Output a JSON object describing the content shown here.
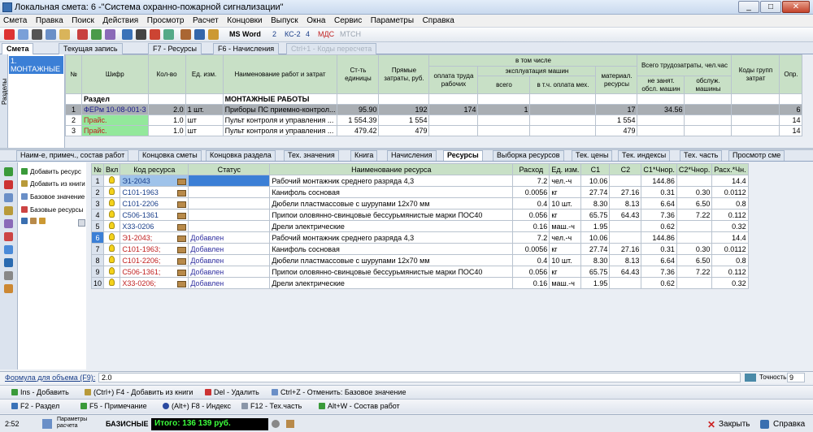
{
  "window": {
    "title": "Локальная смета: 6 -\"Система охранно-пожарной сигнализации\"",
    "min": "_",
    "max": "□",
    "close": "✕"
  },
  "menu": [
    "Смета",
    "Правка",
    "Поиск",
    "Действия",
    "Просмотр",
    "Расчет",
    "Концовки",
    "Выпуск",
    "Окна",
    "Сервис",
    "Параметры",
    "Справка"
  ],
  "toolbar": {
    "msword": "MS Word",
    "n2": "2",
    "ks2": "КС-2",
    "n4": "4",
    "mds": "МДС",
    "mtsn": "МТСН"
  },
  "top_tabs": [
    "Смета",
    "Текущая запись",
    "F7 - Ресурсы",
    "F6 - Начисления",
    "Ctrl+1 - Коды пересчета"
  ],
  "left_strip": "Разделы",
  "sections": {
    "selected": "1. МОНТАЖНЫЕ"
  },
  "estimate_table": {
    "headers": {
      "num": "№",
      "code": "Шифр",
      "qty": "Кол-во",
      "unit": "Ед. изм.",
      "name": "Наименование работ и затрат",
      "unit_cost": "Ст-ть единицы",
      "direct": "Прямые затраты, руб.",
      "incl": "в том числе",
      "wages": "оплата труда рабочих",
      "machine": "эксплуатация машин",
      "total": "всего",
      "incl_wages": "в т.ч. оплата мех.",
      "materials": "материал. ресурсы",
      "labor": "Всего трудозатраты, чел.час",
      "not_busy": "не занят. обсл. машин",
      "service": "обслуж. машины",
      "group_codes": "Коды групп затрат",
      "opr": "Опр."
    },
    "section_row": {
      "label": "Раздел",
      "title": "МОНТАЖНЫЕ РАБОТЫ"
    },
    "rows": [
      {
        "n": "1",
        "code": "ФЕРм 10-08-001-3",
        "qty": "2.0",
        "unit": "1 шт.",
        "name": "Приборы ПС приемно-контрол...",
        "unit_cost": "95.90",
        "direct": "192",
        "wages": "174",
        "mach": "1",
        "mach_w": "",
        "mat": "17",
        "labor": "34.56",
        "serv": "",
        "grp": "",
        "opr": "6"
      },
      {
        "n": "2",
        "code": "Прайс.",
        "qty": "1.0",
        "unit": "шт",
        "name": "Пульт контроля и управления ...",
        "unit_cost": "1 554.39",
        "direct": "1 554",
        "wages": "",
        "mach": "",
        "mach_w": "",
        "mat": "1 554",
        "labor": "",
        "serv": "",
        "grp": "",
        "opr": "14"
      },
      {
        "n": "3",
        "code": "Прайс.",
        "qty": "1.0",
        "unit": "шт",
        "name": "Пульт контроля и управления ...",
        "unit_cost": "479.42",
        "direct": "479",
        "wages": "",
        "mach": "",
        "mach_w": "",
        "mat": "479",
        "labor": "",
        "serv": "",
        "grp": "",
        "opr": "14"
      }
    ]
  },
  "bottom_tabs": [
    "Наим-е, примеч., состав работ",
    "Концовка сметы",
    "Концовка раздела",
    "Тех. значения",
    "Книга",
    "Начисления",
    "Ресурсы",
    "Выборка ресурсов",
    "Тек. цены",
    "Тек. индексы",
    "Тех. часть",
    "Просмотр сме"
  ],
  "resource_panel": [
    "Добавить ресурс",
    "Добавить из книги",
    "Базовое значение",
    "Базовые ресурсы"
  ],
  "resources_table": {
    "headers": {
      "n": "№",
      "incl": "Вкл",
      "code": "Код ресурса",
      "status": "Статус",
      "name": "Наименование ресурса",
      "cons": "Расход",
      "unit": "Ед. изм.",
      "c1": "С1",
      "c2": "С2",
      "c1n": "С1*Чнор.",
      "c2n": "С2*Чнор.",
      "rn": "Расх.*Чн."
    },
    "rows": [
      {
        "n": "1",
        "code": "Э1-2043",
        "status": "",
        "name": "Рабочий монтажник среднего разряда 4,3",
        "cons": "7.2",
        "unit": "чел.-ч",
        "c1": "10.06",
        "c2": "",
        "c1n": "144.86",
        "c2n": "",
        "rn": "14.4",
        "red": false
      },
      {
        "n": "2",
        "code": "С101-1963",
        "status": "",
        "name": "Канифоль сосновая",
        "cons": "0.0056",
        "unit": "кг",
        "c1": "27.74",
        "c2": "27.16",
        "c1n": "0.31",
        "c2n": "0.30",
        "rn": "0.0112",
        "red": false
      },
      {
        "n": "3",
        "code": "С101-2206",
        "status": "",
        "name": "Дюбели пластмассовые с шурупами 12x70 мм",
        "cons": "0.4",
        "unit": "10 шт.",
        "c1": "8.30",
        "c2": "8.13",
        "c1n": "6.64",
        "c2n": "6.50",
        "rn": "0.8",
        "red": false
      },
      {
        "n": "4",
        "code": "С506-1361",
        "status": "",
        "name": "Припои оловянно-свинцовые бессурьмянистые марки ПОС40",
        "cons": "0.056",
        "unit": "кг",
        "c1": "65.75",
        "c2": "64.43",
        "c1n": "7.36",
        "c2n": "7.22",
        "rn": "0.112",
        "red": false
      },
      {
        "n": "5",
        "code": "Х33-0206",
        "status": "",
        "name": "Дрели электрические",
        "cons": "0.16",
        "unit": "маш.-ч",
        "c1": "1.95",
        "c2": "",
        "c1n": "0.62",
        "c2n": "",
        "rn": "0.32",
        "red": false
      },
      {
        "n": "6",
        "code": "Э1-2043;",
        "status": "Добавлен",
        "name": "Рабочий монтажник среднего разряда 4,3",
        "cons": "7.2",
        "unit": "чел.-ч",
        "c1": "10.06",
        "c2": "",
        "c1n": "144.86",
        "c2n": "",
        "rn": "14.4",
        "red": true
      },
      {
        "n": "7",
        "code": "С101-1963;",
        "status": "Добавлен",
        "name": "Канифоль сосновая",
        "cons": "0.0056",
        "unit": "кг",
        "c1": "27.74",
        "c2": "27.16",
        "c1n": "0.31",
        "c2n": "0.30",
        "rn": "0.0112",
        "red": true
      },
      {
        "n": "8",
        "code": "С101-2206;",
        "status": "Добавлен",
        "name": "Дюбели пластмассовые с шурупами 12x70 мм",
        "cons": "0.4",
        "unit": "10 шт.",
        "c1": "8.30",
        "c2": "8.13",
        "c1n": "6.64",
        "c2n": "6.50",
        "rn": "0.8",
        "red": true
      },
      {
        "n": "9",
        "code": "С506-1361;",
        "status": "Добавлен",
        "name": "Припои оловянно-свинцовые бессурьмянистые марки ПОС40",
        "cons": "0.056",
        "unit": "кг",
        "c1": "65.75",
        "c2": "64.43",
        "c1n": "7.36",
        "c2n": "7.22",
        "rn": "0.112",
        "red": true
      },
      {
        "n": "10",
        "code": "Х33-0206;",
        "status": "Добавлен",
        "name": "Дрели электрические",
        "cons": "0.16",
        "unit": "маш.-ч",
        "c1": "1.95",
        "c2": "",
        "c1n": "0.62",
        "c2n": "",
        "rn": "0.32",
        "red": true
      }
    ]
  },
  "formula": {
    "label": "Формула для объема (F9):",
    "value": "2.0",
    "precision_label": "Точность:",
    "precision": "9"
  },
  "hotkeys1": [
    "Ins - Добавить",
    "(Ctrl+) F4 - Добавить из книги",
    "Del - Удалить",
    "Ctrl+Z - Отменить: Базовое значение"
  ],
  "hotkeys2": [
    "F2 - Раздел",
    "F5 - Примечание",
    "(Alt+) F8 - Индекс",
    "F12 - Тех.часть",
    "Alt+W - Состав работ"
  ],
  "status": {
    "time": "2:52",
    "params": "Параметры расчета",
    "mode": "БАЗИСНЫЕ",
    "total": "Итого: 136 139 руб.",
    "close": "Закрыть",
    "help": "Справка"
  },
  "colors": {
    "header_green": "#c8e0c6",
    "row_green": "#93e89b",
    "selection_blue": "#3b7fd6",
    "added_red": "#c02020",
    "total_bg": "#000000",
    "total_fg": "#3cff3c"
  }
}
